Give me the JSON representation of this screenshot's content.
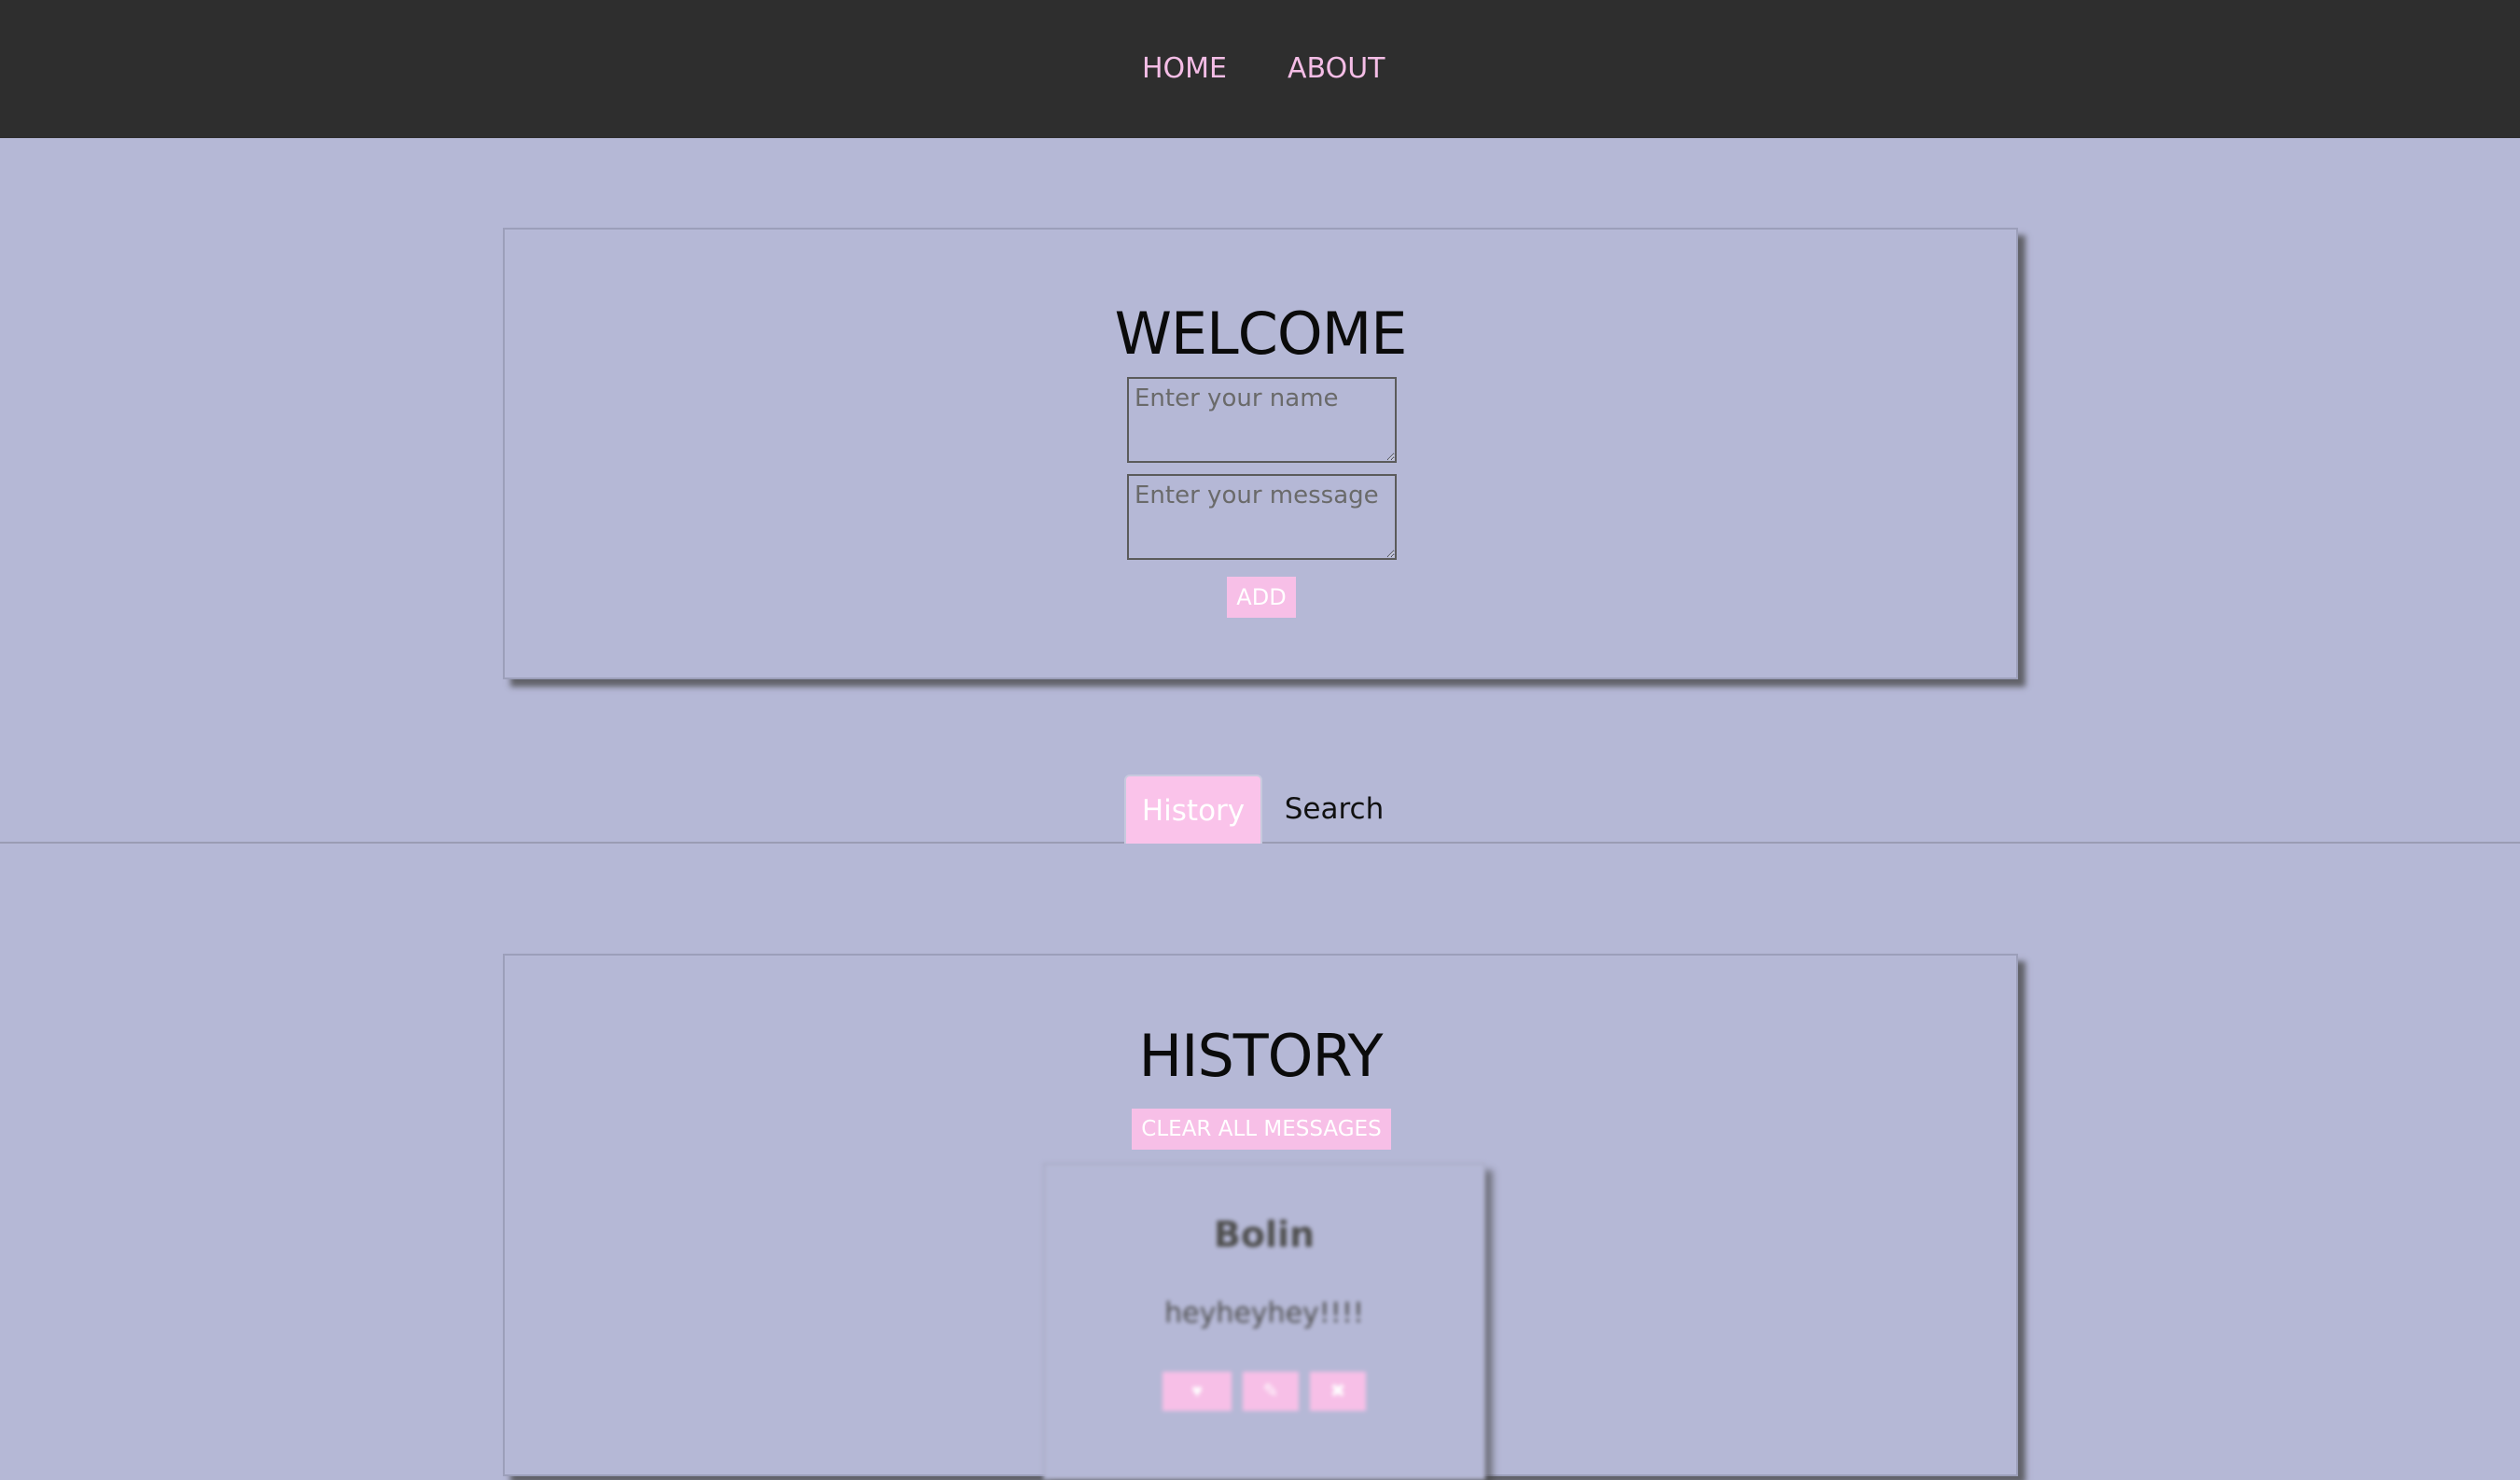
{
  "nav": {
    "home_label": "HOME",
    "about_label": "ABOUT"
  },
  "welcome": {
    "title": "WELCOME",
    "name_placeholder": "Enter your name",
    "message_placeholder": "Enter your message",
    "add_label": "ADD"
  },
  "tabs": [
    {
      "label": "History",
      "active": true
    },
    {
      "label": "Search",
      "active": false
    }
  ],
  "history": {
    "title": "HISTORY",
    "clear_label": "CLEAR ALL MESSAGES",
    "messages": [
      {
        "name": "Bolin",
        "text": "heyheyhey!!!!",
        "action_icons": [
          "like-icon",
          "edit-icon",
          "delete-icon"
        ]
      }
    ]
  },
  "colors": {
    "page_background": "#b5b8d6",
    "navbar_background": "#2e2e2e",
    "accent_pink": "#f7bfe7",
    "nav_link": "#f4bde6"
  }
}
